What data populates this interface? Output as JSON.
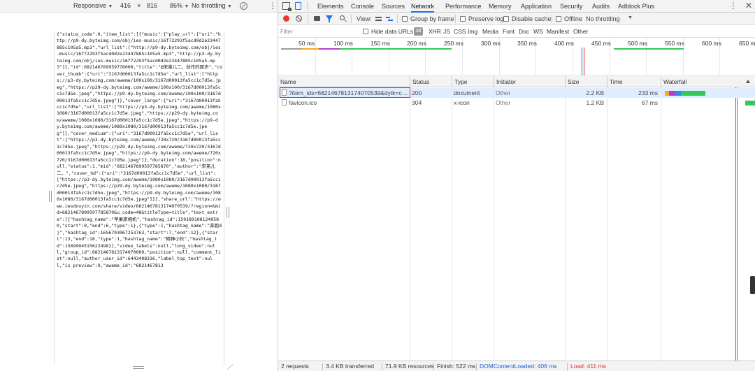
{
  "device_toolbar": {
    "device": "Responsive",
    "width": "416",
    "times": "×",
    "height": "816",
    "zoom": "86%",
    "throttling": "No throttling"
  },
  "page_content": {
    "json_text": "{\"status_code\":0,\"item_list\":[{\"music\":{\"play_url\":{\"uri\":\"http://p9-dy.byteimg.com/obj/ies-music/16f72293f5acd0d2e23447885c105a5.mp3\",\"url_list\":[\"http://p9-dy.byteimg.com/obj/ies-music/16f72293f5acd0d2e23447885c105a5.mp3\",\"http://p3-dy.byteimg.com/obj/ies-music/16f72293f5acd0d2e23447885c105a5.mp3\"]},\"id\":682146789959776000,\"title\":\"@宋弟儿二，创作的原声\",\"cover_thumb\":{\"uri\":\"3167d00013fa5cc1c7d5e\",\"url_list\":[\"https://p3-dy.byteimg.com/aweme/100x100/3167d00013fa5cc1c7d5e.jpeg\",\"https://p29-dy.byteimg.com/aweme/100x100/3167d00013fa5cc1c7d5e.jpeg\",\"https://p9-dy.byteimg.com/aweme/100x100/3167d00013fa5cc1c7d5e.jpeg\"]},\"cover_large\":{\"uri\":\"3167d00013fa5cc1c7d5e\",\"url_list\":[\"https://p3-dy.byteimg.com/aweme/1080x1080/3167d00013fa5cc1c7d5e.jpeg\",\"https://p29-dy.byteimg.com/aweme/1080x1080/3167d00013fa5cc1c7d5e.jpeg\",\"https://p9-dy.byteimg.com/aweme/1080x1080/3167d00013fa5cc1c7d5e.jpeg\"]},\"cover_medium\":{\"uri\":\"3167d00013fa5cc1c7d5e\",\"url_list\":[\"https://p3-dy.byteimg.com/aweme/720x720/3167d00013fa5cc1c7d5e.jpeg\",\"https://p29-dy.byteimg.com/aweme/720x720/3167d00013fa5cc1c7d5e.jpeg\",\"https://p9-dy.byteimg.com/aweme/720x720/3167d00013fa5cc1c7d5e.jpeg\"]},\"duration\":18,\"position\":null,\"status\":1,\"mid\":\"6821467899597785870\",\"author\":\"宋弟儿二，\",\"cover_hd\":{\"uri\":\"3167d00013fa5cc1c7d5e\",\"url_list\":[\"https://p3-dy.byteimg.com/aweme/1080x1080/3167d00013fa5cc1c7d5e.jpeg\",\"https://p29-dy.byteimg.com/aweme/1080x1080/3167d00013fa5cc1c7d5e.jpeg\",\"https://p9-dy.byteimg.com/aweme/1080x1080/3167d00013fa5cc1c7d5e.jpeg\"]}},\"share_url\":\"https://www.iesdouyin.com/share/video/6821467813174070539/?region=&mid=6821467899597785870&u_code=48&titleType=title\",\"text_extra\":[{\"hashtag_name\":\"苹果原相机\",\"hashtag_id\":1591891081240580,\"start\":0,\"end\":6,\"type\":1},{\"type\":1,\"hashtag_name\":\"奔跑dj\",\"hashtag_id\":1656793067253763,\"start\":7,\"end\":12},{\"start\":13,\"end\":18,\"type\":1,\"hashtag_name\":\"精神小伙\",\"hashtag_id\":1569904515622498}],\"video_labels\":null,\"long_video\":null,\"group_id\":6821467813174070000,\"position\":null,\"comment_list\":null,\"author_user_id\":6443408336,\"label_top_text\":null,\"is_preview\":0,\"aweme_id\":\"6821467813"
  },
  "tabs": [
    "Elements",
    "Console",
    "Sources",
    "Network",
    "Performance",
    "Memory",
    "Application",
    "Security",
    "Audits",
    "Adblock Plus"
  ],
  "active_tab": "Network",
  "network_toolbar": {
    "view_label": "View:",
    "group_by_frame": "Group by frame",
    "preserve_log": "Preserve log",
    "disable_cache": "Disable cache",
    "offline": "Offline",
    "throttling": "No throttling"
  },
  "filter_bar": {
    "placeholder": "Filter",
    "hide_data_urls": "Hide data URLs",
    "all": "All",
    "types": [
      "XHR",
      "JS",
      "CSS",
      "Img",
      "Media",
      "Font",
      "Doc",
      "WS",
      "Manifest",
      "Other"
    ]
  },
  "overview": {
    "ticks": [
      "50 ms",
      "100 ms",
      "150 ms",
      "200 ms",
      "250 ms",
      "300 ms",
      "350 ms",
      "400 ms",
      "450 ms",
      "500 ms",
      "550 ms",
      "600 ms",
      "650 m"
    ]
  },
  "columns": [
    "Name",
    "Status",
    "Type",
    "Initiator",
    "Size",
    "Time",
    "Waterfall"
  ],
  "requests": [
    {
      "name": "?item_ids=6821467813174070539&dytk=c86...",
      "status": "200",
      "type": "document",
      "initiator": "Other",
      "size": "2.2 KB",
      "time": "233 ms"
    },
    {
      "name": "favicon.ico",
      "status": "304",
      "type": "x-icon",
      "initiator": "Other",
      "size": "1.2 KB",
      "time": "67 ms"
    }
  ],
  "status_bar": {
    "requests": "2 requests",
    "transferred": "3.4 KB transferred",
    "resources": "71.9 KB resources",
    "finish": "Finish: 522 ms",
    "dom_content_loaded": "DOMContentLoaded: 406 ms",
    "load": "Load: 411 ms"
  },
  "colors": {
    "accent": "#1a73e8",
    "dom_content_loaded": "#1a5fd6",
    "load": "#d93025",
    "highlight": "#e0322f"
  }
}
